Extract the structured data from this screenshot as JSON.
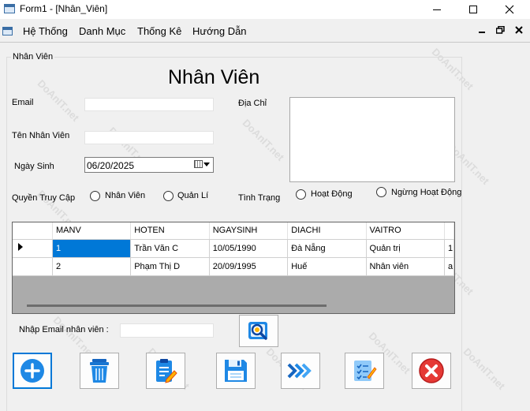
{
  "window": {
    "title": "Form1 - [Nhân_Viên]"
  },
  "menu": {
    "items": [
      "Hệ Thống",
      "Danh Mục",
      "Thống Kê",
      "Hướng Dẫn"
    ]
  },
  "group": {
    "legend": "Nhân Viên"
  },
  "form": {
    "heading": "Nhân Viên",
    "email_label": "Email",
    "name_label": "Tên Nhân Viên",
    "dob_label": "Ngày Sinh",
    "dob_value": "06/20/2025",
    "address_label": "Địa Chỉ",
    "role_label": "Quyền Truy Cập",
    "role_options": [
      "Nhân Viên",
      "Quản Lí"
    ],
    "status_label": "Tình Trạng",
    "status_options": [
      "Hoạt Động",
      "Ngừng Hoạt Động"
    ]
  },
  "grid": {
    "columns": [
      "MANV",
      "HOTEN",
      "NGAYSINH",
      "DIACHI",
      "VAITRO",
      ""
    ],
    "rows": [
      [
        "1",
        "Trần Văn C",
        "10/05/1990",
        "Đà Nẵng",
        "Quản trị",
        "1"
      ],
      [
        "2",
        "Phạm Thị D",
        "20/09/1995",
        "Huế",
        "Nhân viên",
        "a"
      ]
    ]
  },
  "search": {
    "label": "Nhập Email nhân viên :",
    "value": ""
  },
  "icons": {
    "search": "search-icon",
    "add": "plus-icon",
    "delete": "trash-icon",
    "edit": "clipboard-edit-icon",
    "save": "floppy-disk-icon",
    "next": "arrows-right-icon",
    "report": "checklist-icon",
    "close": "close-icon"
  },
  "colors": {
    "selection": "#0078d7",
    "focus": "#0078d7",
    "close_red": "#e53935",
    "icon_blue": "#1565c0"
  },
  "watermark": "DoAnIT.net"
}
